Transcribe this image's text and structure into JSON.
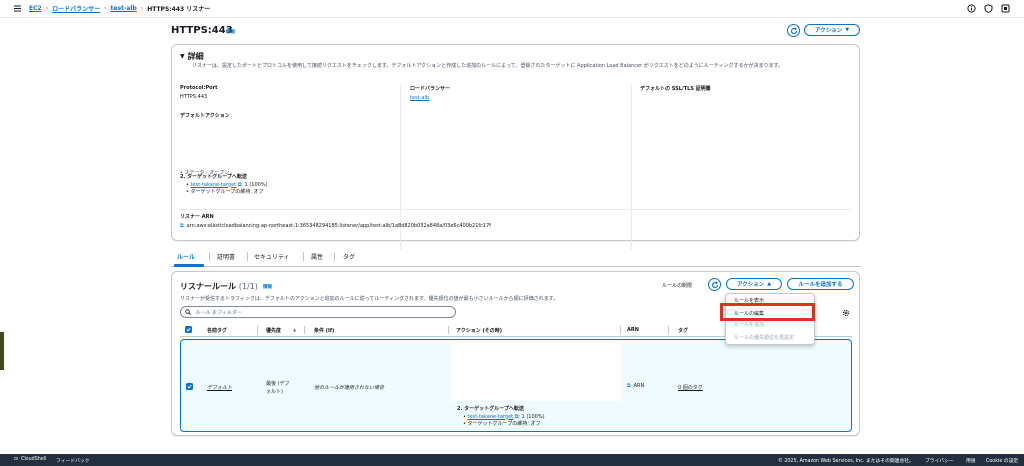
{
  "breadcrumb": {
    "ec2": "EC2",
    "lb": "ロードバランサー",
    "alb": "test-alb",
    "current": "HTTPS:443 リスナー"
  },
  "header": {
    "title": "HTTPS:443",
    "info": "情報",
    "action": "アクション"
  },
  "details": {
    "title": "詳細",
    "desc": "リスナーは、設定したポートとプロトコルを使用して接続リクエストをチェックします。デフォルトアクションと作成した追加のルールによって、登録されたターゲットに Application Load Balancer がリクエストをどのようにルーティングするかが決まります。",
    "protocol_label": "Protocol:Port",
    "protocol_value": "HTTPS:443",
    "lb_label": "ロードバランサー",
    "lb_value": "test-alb",
    "ssl_label": "デフォルトの SSL/TLS 証明書",
    "default_action_label": "デフォルトアクション",
    "partial": "• ステータ - オープン",
    "forward": "2. ターゲットグループへ転送",
    "target": "test-takane-target",
    "weight": ": 1 (100%)",
    "stickiness": "ターゲットグループの維持: オフ",
    "arn_label": "リスナー ARN",
    "arn_value": "arn:aws:elasticloadbalancing:ap-northeast-1:365348294185:listener/app/test-alb/1a8d820b032a848a/03e5c400b21fc17f"
  },
  "tabs": [
    "ルール",
    "証明書",
    "セキュリティ",
    "属性",
    "タグ"
  ],
  "rules": {
    "title": "リスナールール",
    "count": "(1/1)",
    "info": "情報",
    "desc": "リスナーが受信するトラフィックは、デフォルトのアクションと追加のルールに従ってルーティングされます。優先順位の値が最も小さいルールから順に評価されます。",
    "limit": "ルールの制限",
    "action": "アクション",
    "add": "ルールを追加する",
    "filter_placeholder": "ルール をフィルター",
    "headers": {
      "name": "名前タグ",
      "priority": "優先度",
      "conditions": "条件 (If)",
      "actions": "アクション (その時)",
      "arn": "ARN",
      "tags": "タグ"
    },
    "row": {
      "name": "デフォルト",
      "priority_l1": "最後 (デフ",
      "priority_l2": "ォルト)",
      "condition": "他のルールが適用されない場合",
      "forward": "2. ターゲットグループへ転送",
      "target": "test-takane-target",
      "weight": ": 1 (100%)",
      "stickiness": "ターゲットグループの維持: オフ",
      "arn": "ARN",
      "tags": "0 個のタグ"
    }
  },
  "dropdown": [
    "ルールを表示",
    "ルールの編集",
    "ルールを追加",
    "ルールの優先順位を再設定"
  ],
  "footer": {
    "cloudshell": "CloudShell",
    "feedback": "フィードバック",
    "copyright": "© 2025, Amazon Web Services, Inc. またはその関連会社。",
    "privacy": "プライバシー",
    "terms": "用語",
    "cookie": "Cookie の設定"
  }
}
